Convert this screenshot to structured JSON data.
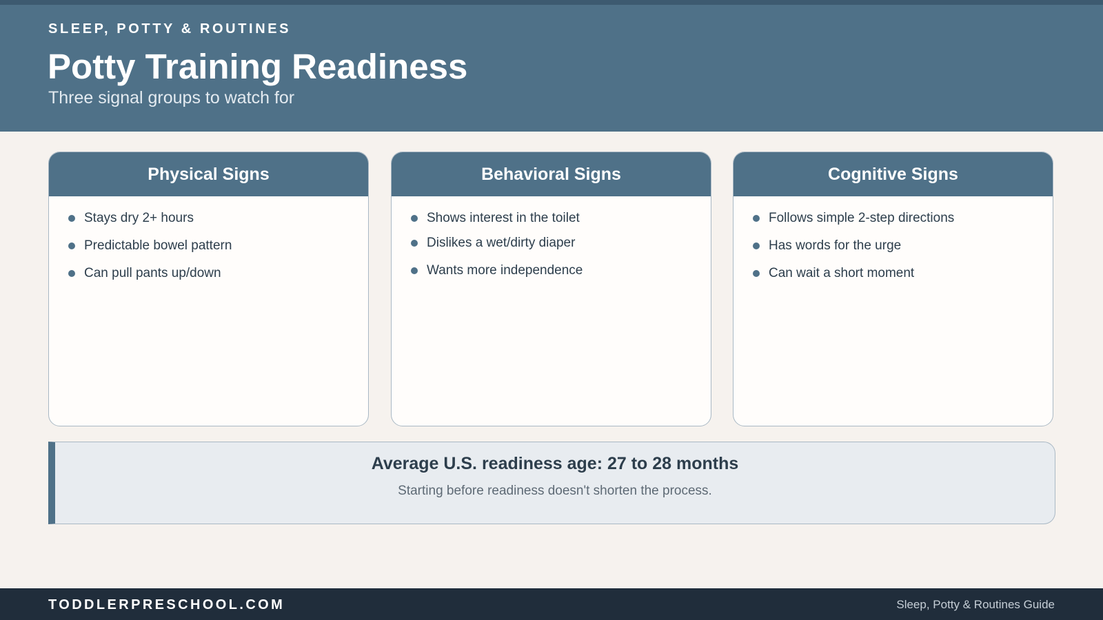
{
  "header": {
    "eyebrow": "SLEEP, POTTY & ROUTINES",
    "title": "Potty Training Readiness",
    "subtitle": "Three signal groups to watch for"
  },
  "cards": [
    {
      "title": "Physical Signs",
      "items": [
        "Stays dry 2+ hours",
        "Predictable bowel pattern",
        "Can pull pants up/down"
      ]
    },
    {
      "title": "Behavioral Signs",
      "items": [
        "Shows interest in the toilet",
        "Dislikes a wet/dirty diaper",
        "Wants more independence"
      ]
    },
    {
      "title": "Cognitive Signs",
      "items": [
        "Follows simple 2-step directions",
        "Has words for the urge",
        "Can wait a short moment"
      ]
    }
  ],
  "callout": {
    "title": "Average U.S. readiness age: 27 to 28 months",
    "note": "Starting before readiness doesn't shorten the process."
  },
  "footer": {
    "site": "TODDLERPRESCHOOL.COM",
    "guide": "Sleep, Potty & Routines Guide"
  },
  "colors": {
    "primary": "#4f7188",
    "background": "#f6f2ee",
    "footer": "#202d3b",
    "callout_bg": "#e8ecf0"
  }
}
